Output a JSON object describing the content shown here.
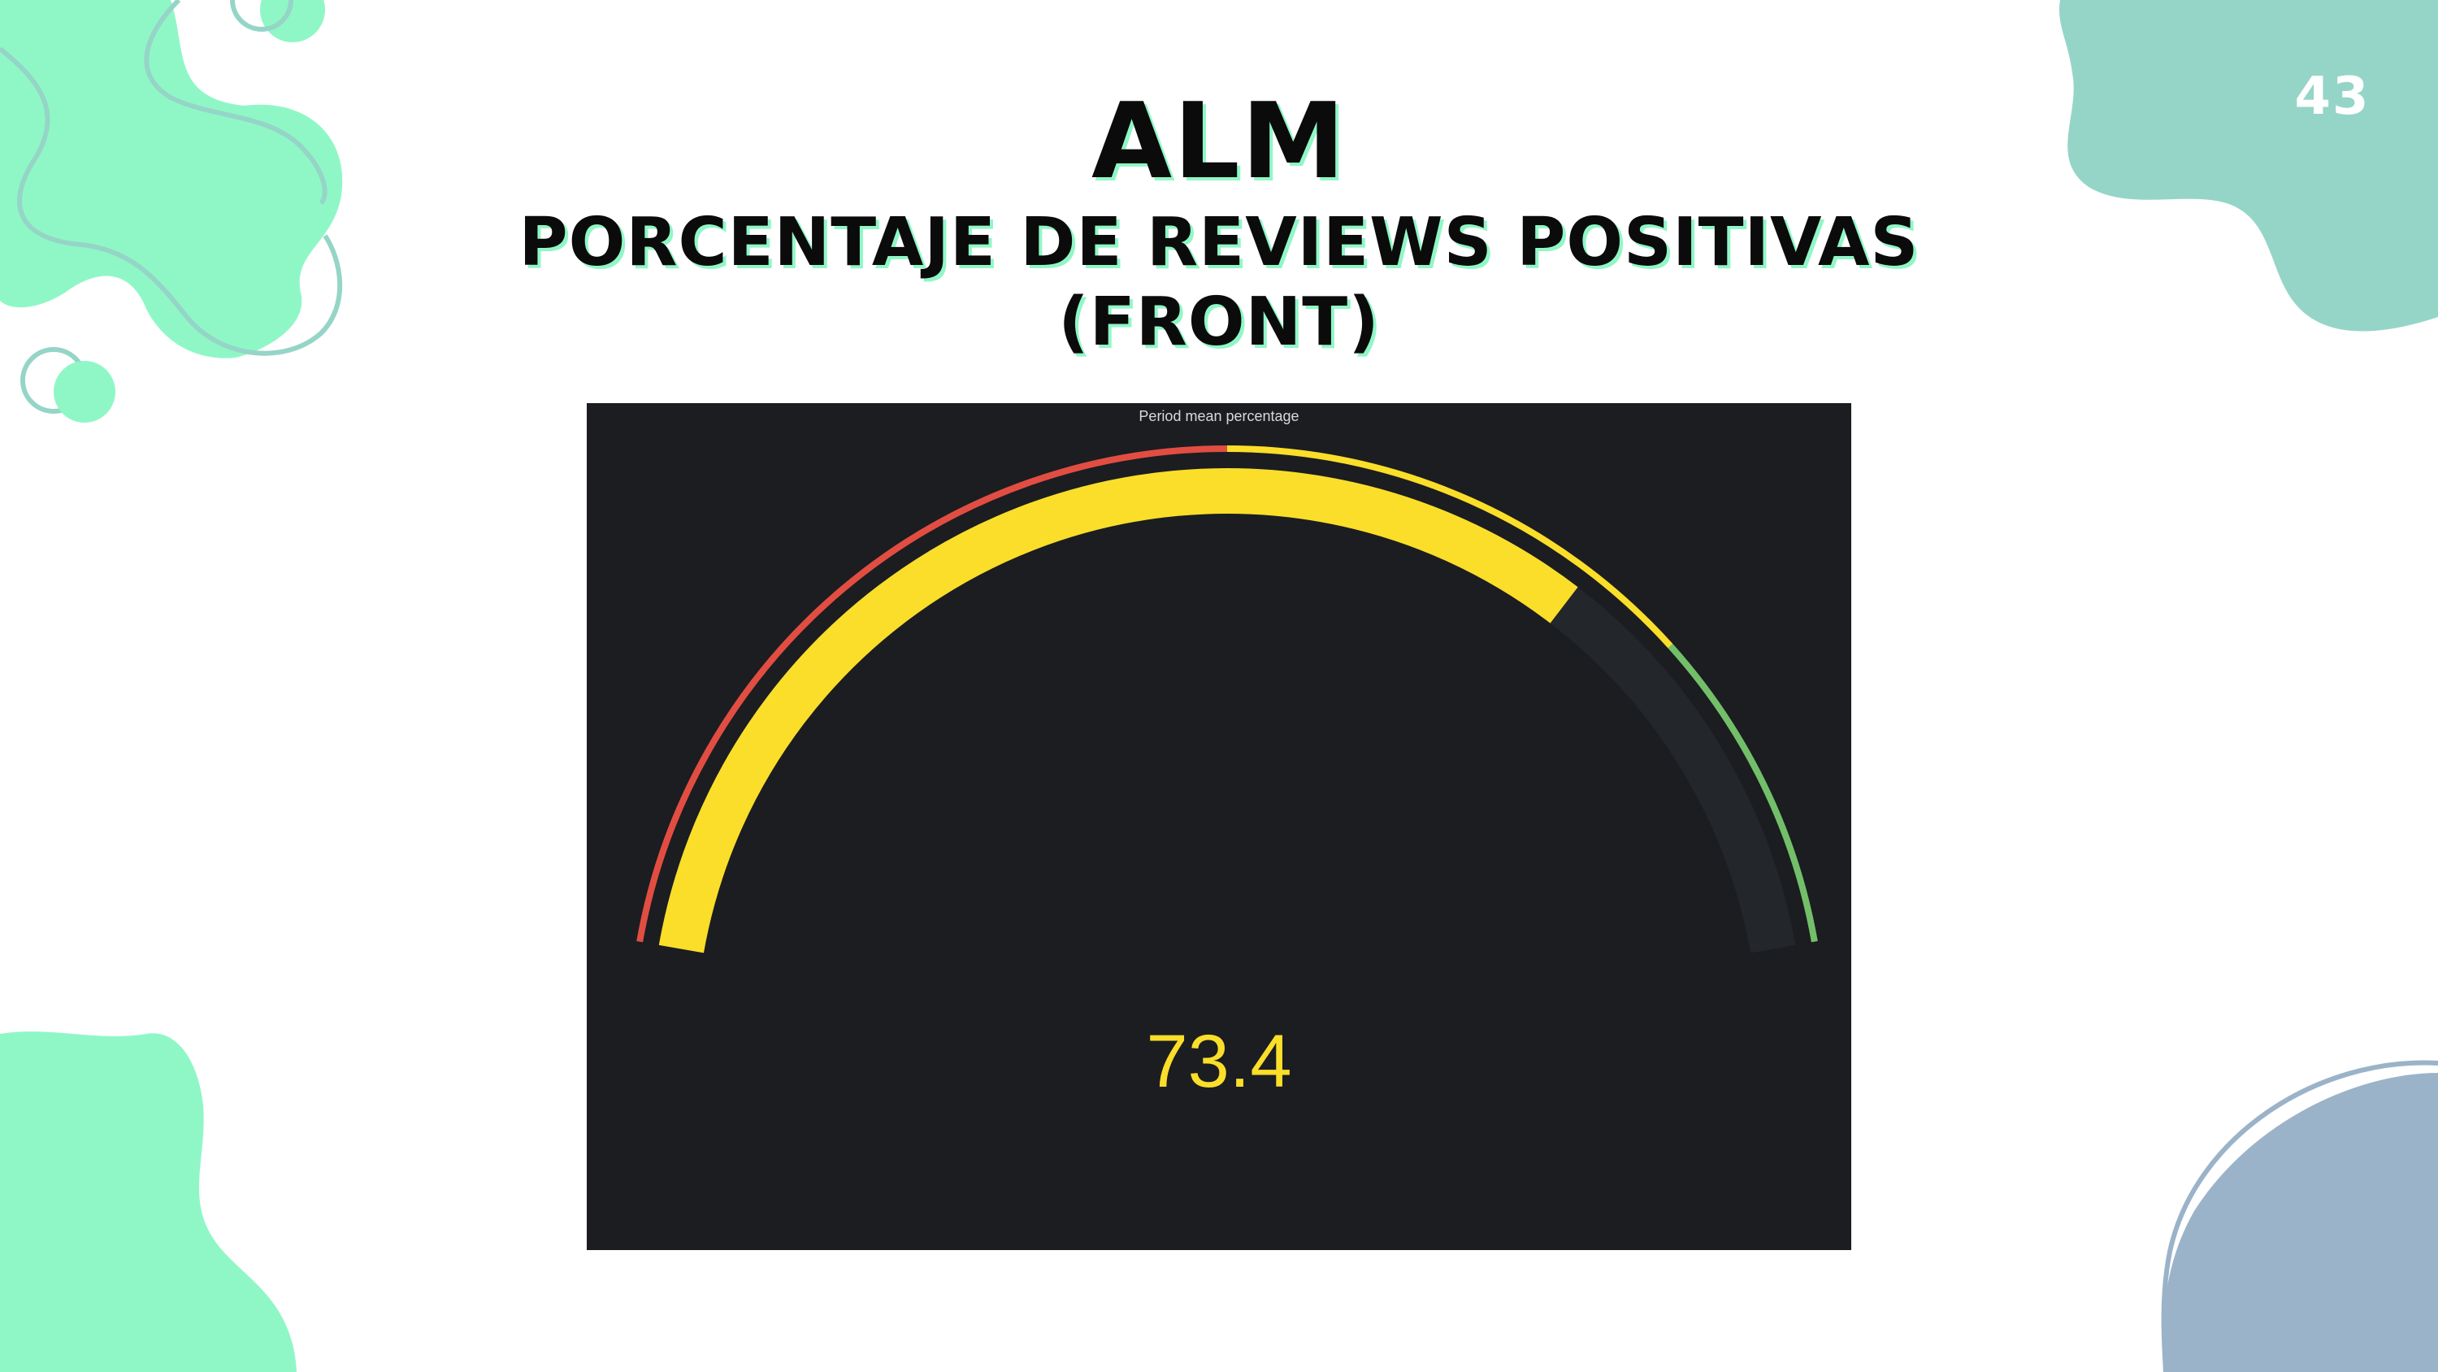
{
  "slide": {
    "page_number": "43",
    "title": "ALM",
    "subtitle_line1": "PORCENTAJE DE REVIEWS POSITIVAS",
    "subtitle_line2": "(FRONT)"
  },
  "colors": {
    "mint": "#8ff7c6",
    "teal": "#95d5c7",
    "slate_blue": "#9bb3c9",
    "panel_bg": "#1b1d21",
    "gauge_value": "#fade2a",
    "threshold_red": "#e24d42",
    "threshold_yellow": "#fade2a",
    "threshold_green": "#73bf69",
    "gauge_track": "#23262b"
  },
  "chart_data": {
    "type": "gauge",
    "title": "Period mean percentage",
    "value": 73.4,
    "display_value": "73.4",
    "min": 0,
    "max": 100,
    "thresholds": [
      {
        "from": 0,
        "to": 50,
        "color": "#e24d42"
      },
      {
        "from": 50,
        "to": 80,
        "color": "#fade2a"
      },
      {
        "from": 80,
        "to": 100,
        "color": "#73bf69"
      }
    ]
  }
}
